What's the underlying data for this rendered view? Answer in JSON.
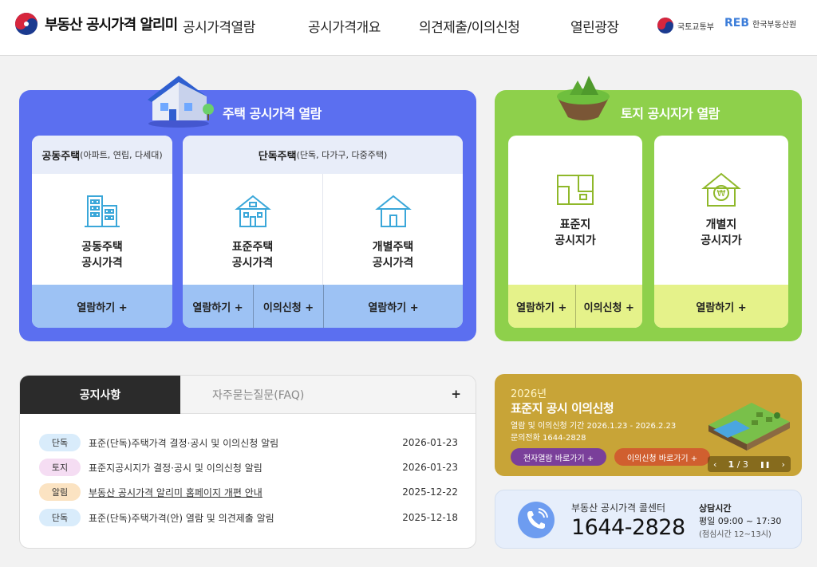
{
  "header": {
    "logo_text": "부동산 공시가격 알리미",
    "nav": [
      "공시가격열람",
      "공시가격개요",
      "의견제출/이의신청",
      "열린광장"
    ],
    "partner1": "국토교통부",
    "partner2_logo": "REB",
    "partner2": "한국부동산원"
  },
  "house": {
    "title": "주택 공시가격 열람",
    "apt_head": "공동주택",
    "apt_head_sub": "(아파트, 연립, 다세대)",
    "detached_head": "단독주택",
    "detached_head_sub": "(단독, 다가구, 다중주택)",
    "items": [
      {
        "line1": "공동주택",
        "line2": "공시가격",
        "icon": "apartment-icon"
      },
      {
        "line1": "표준주택",
        "line2": "공시가격",
        "icon": "standard-house-icon"
      },
      {
        "line1": "개별주택",
        "line2": "공시가격",
        "icon": "individual-house-icon"
      }
    ],
    "view_label": "열람하기 +",
    "objection_label": "이의신청 +"
  },
  "land": {
    "title": "토지 공시지가 열람",
    "items": [
      {
        "line1": "표준지",
        "line2": "공시지가",
        "icon": "land-map-icon"
      },
      {
        "line1": "개별지",
        "line2": "공시지가",
        "icon": "won-house-icon"
      }
    ],
    "view_label": "열람하기 +",
    "objection_label": "이의신청 +"
  },
  "notice": {
    "tab_active": "공지사항",
    "tab_inactive": "자주묻는질문(FAQ)",
    "more": "+",
    "rows": [
      {
        "badge": "단독",
        "color": "#d9ecfb",
        "title": "표준(단독)주택가격 결정·공시 및 이의신청 알림",
        "date": "2026-01-23"
      },
      {
        "badge": "토지",
        "color": "#f5ddf3",
        "title": "표준지공시지가 결정·공시 및 이의신청 알림",
        "date": "2026-01-23"
      },
      {
        "badge": "알림",
        "color": "#fbe3c2",
        "title": "부동산 공시가격 알리미 홈페이지 개편 안내",
        "date": "2025-12-22"
      },
      {
        "badge": "단독",
        "color": "#d9ecfb",
        "title": "표준(단독)주택가격(안) 열람 및 의견제출 알림",
        "date": "2025-12-18"
      }
    ]
  },
  "banner": {
    "year": "2026년",
    "title": "표준지 공시 이의신청",
    "line1": "열람 및 이의신청 기간 2026.1.23 - 2026.2.23",
    "line2": "문의전화 1644-2828",
    "btn1": "전자열람 바로가기 +",
    "btn2": "이의신청 바로가기 +",
    "prev": "‹",
    "current": "1",
    "slash": "/",
    "total": "3",
    "pause": "❚❚",
    "next": "›"
  },
  "call": {
    "name": "부동산 공시가격 콜센터",
    "number": "1644-2828",
    "hours_title": "상담시간",
    "hours": "평일 09:00 ~ 17:30",
    "lunch": "(점심시간 12~13시)"
  }
}
